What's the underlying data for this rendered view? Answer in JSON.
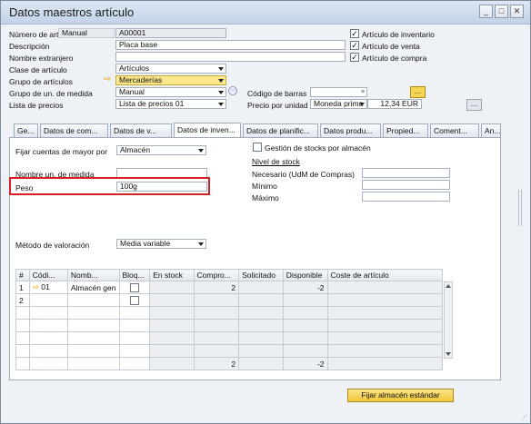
{
  "window": {
    "title": "Datos maestros artículo"
  },
  "header": {
    "item_number_label": "Número de artí",
    "item_number_mode": "Manual",
    "item_number_value": "A00001",
    "description_label": "Descripción",
    "description_value": "Placa base",
    "foreign_name_label": "Nombre extranjero",
    "foreign_name_value": "",
    "item_class_label": "Clase de artículo",
    "item_class_value": "Artículos",
    "item_group_label": "Grupo de artículos",
    "item_group_value": "Mercaderías",
    "uom_group_label": "Grupo de un. de medida",
    "uom_group_value": "Manual",
    "price_list_label": "Lista de precios",
    "price_list_value": "Lista de precios 01",
    "barcode_label": "Código de barras",
    "barcode_value": "",
    "unit_price_label": "Precio por unidad",
    "currency_value": "Moneda prima",
    "unit_price_value": "12,34 EUR",
    "checks": [
      {
        "label": "Artículo de inventario",
        "checked": true
      },
      {
        "label": "Artículo de venta",
        "checked": true
      },
      {
        "label": "Artículo de compra",
        "checked": true
      }
    ]
  },
  "tabs": [
    "Ge...",
    "Datos de com...",
    "Datos de v...",
    "Datos de inven...",
    "Datos de planific...",
    "Datos produ...",
    "Propied...",
    "Coment...",
    "An..."
  ],
  "inventory": {
    "gl_method_label": "Fijar cuentas de mayor por",
    "gl_method_value": "Almacén",
    "manage_by_wh_label": "Gestión de stocks por almacén",
    "uom_name_label": "Nombre un. de medida",
    "uom_name_value": "",
    "weight_label": "Peso",
    "weight_value": "100g",
    "stock_level_title": "Nivel de stock",
    "required_label": "Necesario (UdM de Compras)",
    "minimum_label": "Mínimo",
    "maximum_label": "Máximo",
    "valuation_label": "Método de valoración",
    "valuation_value": "Media variable"
  },
  "grid": {
    "columns": [
      "#",
      "Códi...",
      "Nomb...",
      "Bloq...",
      "En stock",
      "Compro...",
      "Solicitado",
      "Disponible",
      "Coste de artículo"
    ],
    "rows": [
      {
        "num": "1",
        "code": "01",
        "name": "Almacén gen",
        "locked": false,
        "in_stock": "",
        "committed": "2",
        "ordered": "",
        "available": "-2",
        "cost": ""
      },
      {
        "num": "2",
        "code": "",
        "name": "",
        "locked": false,
        "in_stock": "",
        "committed": "",
        "ordered": "",
        "available": "",
        "cost": ""
      }
    ],
    "totals": {
      "committed": "2",
      "available": "-2"
    }
  },
  "actions": {
    "set_default_wh_label": "Fijar almacén estándar"
  },
  "colors": {
    "accent_yellow": "#f0c63a",
    "highlight_red": "#d6202a"
  }
}
